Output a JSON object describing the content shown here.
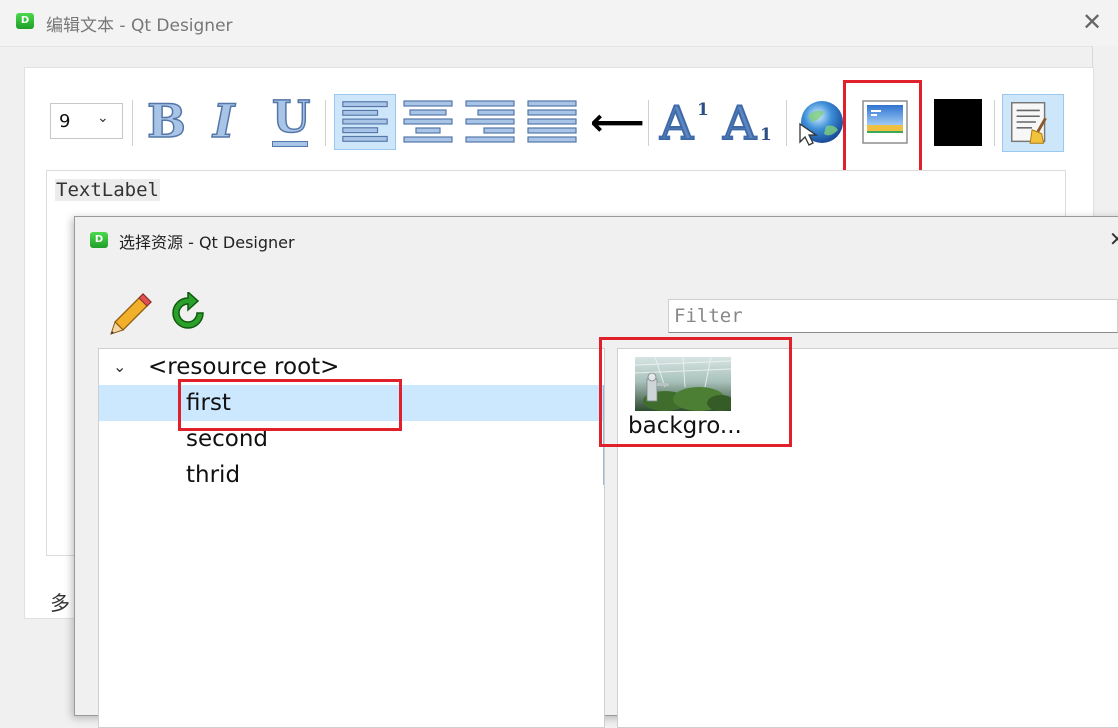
{
  "main_window": {
    "app_icon_letter": "D",
    "title": "编辑文本 - Qt Designer",
    "close_glyph": "✕"
  },
  "toolbar": {
    "font_size": "9",
    "dropdown_glyph": "⌄",
    "bold_glyph": "B",
    "italic_glyph": "I",
    "underline_glyph": "U",
    "superscript_base": "A",
    "superscript_mark": "1",
    "subscript_base": "A",
    "subscript_mark": "1",
    "arrow_glyph": "⟵",
    "color_swatch": "#000000"
  },
  "editor": {
    "content": "TextLabel"
  },
  "bottom_label": "多",
  "dialog": {
    "app_icon_letter": "D",
    "title": "选择资源 - Qt Designer",
    "close_glyph": "✕",
    "filter_placeholder": "Filter",
    "tree": {
      "caret": "⌄",
      "root": "<resource root>",
      "items": [
        "first",
        "second",
        "thrid"
      ],
      "selected_index": 0
    },
    "resources": [
      {
        "label": "backgro..."
      }
    ]
  },
  "colors": {
    "highlight": "#e0202a",
    "selection": "#cce8ff",
    "active_button": "#cde6fa"
  }
}
